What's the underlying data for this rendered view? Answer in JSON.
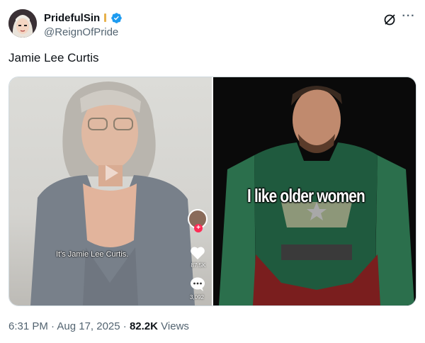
{
  "author": {
    "display_name": "PridefulSin",
    "handle": "@ReignOfPride",
    "verified": true,
    "avatar_icon": "anime-avatar-icon"
  },
  "tweet": {
    "text": "Jamie Lee Curtis"
  },
  "media": {
    "left": {
      "caption": "It's Jamie Lee Curtis.",
      "likes": "87.5K",
      "comments": "3,092"
    },
    "right": {
      "caption": "I like older women"
    }
  },
  "meta": {
    "timestamp": "6:31 PM · Aug 17, 2025 · ",
    "views_count": "82.2K",
    "views_label": "Views"
  },
  "colors": {
    "verified": "#1d9bf0",
    "secondary_text": "#536471",
    "primary_text": "#0f1419",
    "tiktok_red": "#fe2c55"
  }
}
